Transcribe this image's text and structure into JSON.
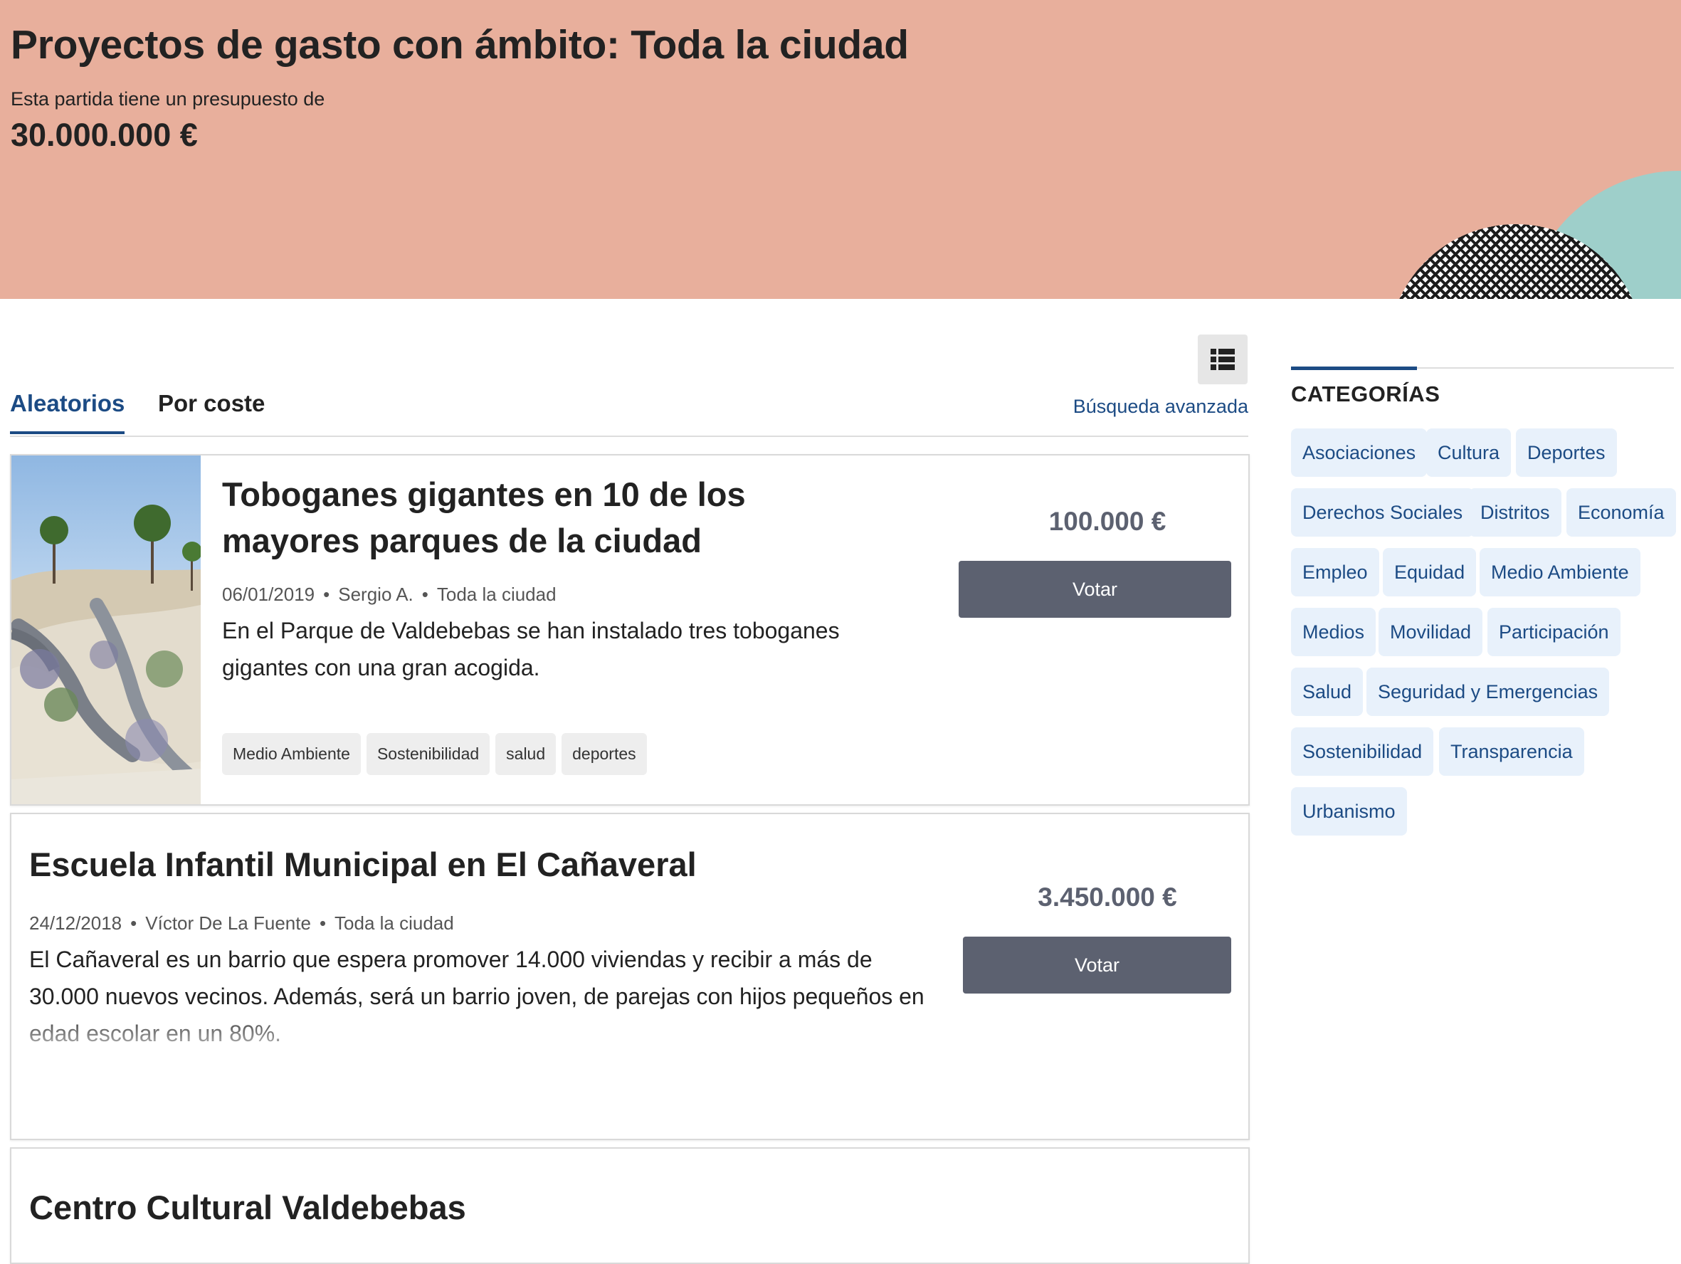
{
  "header": {
    "title": "Proyectos de gasto con ámbito: Toda la ciudad",
    "budget_label": "Esta partida tiene un presupuesto de",
    "budget_amount": "30.000.000 €"
  },
  "tabs": {
    "random": "Aleatorios",
    "by_cost": "Por coste",
    "active": "Aleatorios"
  },
  "advanced_search": "Búsqueda avanzada",
  "view_toggle_icon": "list-view-icon",
  "projects": [
    {
      "title": "Toboganes gigantes en 10 de los mayores parques de la ciudad",
      "date": "06/01/2019",
      "author": "Sergio A.",
      "scope": "Toda la ciudad",
      "description": "En el Parque de Valdebebas se han instalado tres toboganes gigantes con una gran acogida.",
      "tags": [
        "Medio Ambiente",
        "Sostenibilidad",
        "salud",
        "deportes"
      ],
      "price": "100.000 €",
      "vote_label": "Votar"
    },
    {
      "title": "Escuela Infantil Municipal en El Cañaveral",
      "date": "24/12/2018",
      "author": "Víctor De La Fuente",
      "scope": "Toda la ciudad",
      "description": "El Cañaveral es un barrio que espera promover 14.000 viviendas y recibir a más de 30.000 nuevos vecinos. Además, será un barrio joven, de parejas con hijos pequeños en edad escolar en un 80%.",
      "price": "3.450.000 €",
      "vote_label": "Votar"
    },
    {
      "title": "Centro Cultural Valdebebas"
    }
  ],
  "sidebar": {
    "title": "CATEGORÍAS",
    "categories": [
      "Asociaciones",
      "Cultura",
      "Deportes",
      "Derechos Sociales",
      "Distritos",
      "Economía",
      "Empleo",
      "Equidad",
      "Medio Ambiente",
      "Medios",
      "Movilidad",
      "Participación",
      "Salud",
      "Seguridad y Emergencias",
      "Sostenibilidad",
      "Transparencia",
      "Urbanismo"
    ]
  },
  "colors": {
    "header_bg": "#e8af9c",
    "accent_blue": "#1c4b84",
    "vote_button": "#5c6170",
    "category_bg": "#e8f1fb",
    "deco_teal": "#9ecfca"
  }
}
